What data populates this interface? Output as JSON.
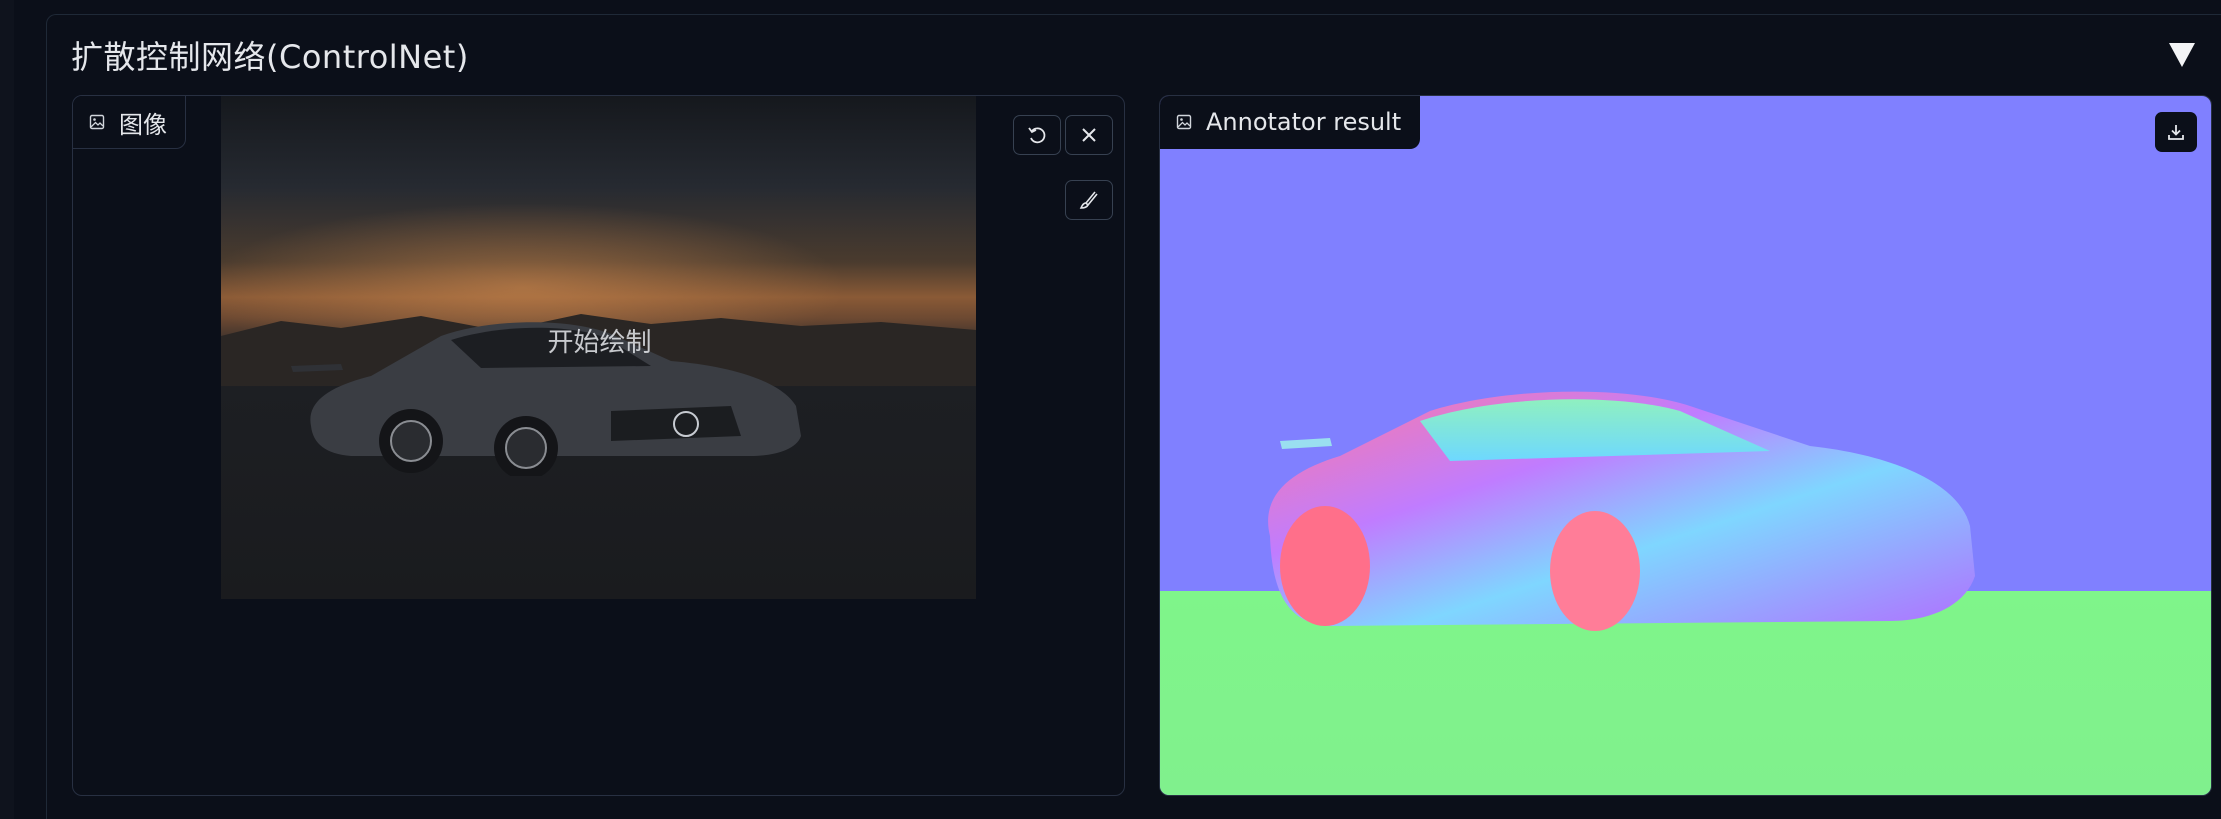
{
  "panel": {
    "title": "扩散控制网络(ControlNet)"
  },
  "input_image": {
    "label": "图像",
    "overlay_text": "开始绘制",
    "icons": [
      "undo-icon",
      "close-icon",
      "brush-icon",
      "image-icon"
    ]
  },
  "annotator": {
    "label": "Annotator result",
    "icons": [
      "download-icon",
      "image-icon"
    ]
  },
  "colors": {
    "background": "#0b0f19",
    "border": "#283042",
    "normal_map_sky": "#8080ff",
    "normal_map_ground": "#80f08d"
  }
}
